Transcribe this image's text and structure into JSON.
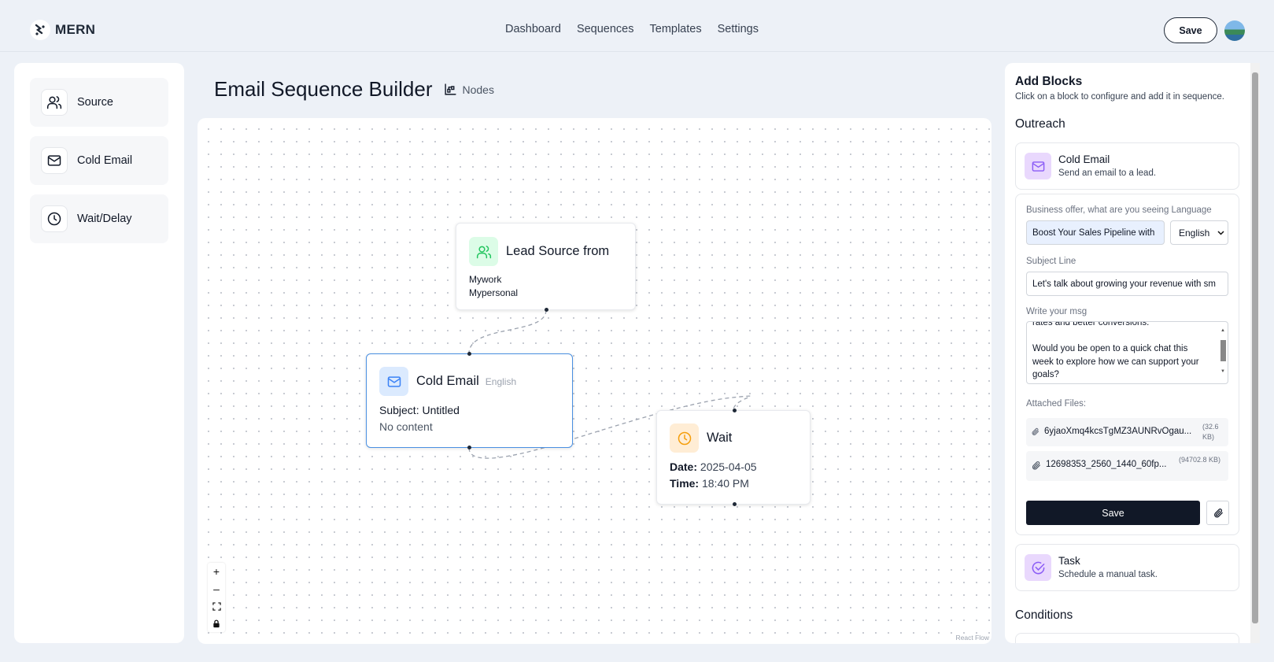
{
  "app": {
    "logo_text": "MERN"
  },
  "nav": {
    "items": [
      "Dashboard",
      "Sequences",
      "Templates",
      "Settings"
    ]
  },
  "header": {
    "save_label": "Save"
  },
  "sidebar": {
    "items": [
      {
        "label": "Source",
        "icon": "users-icon"
      },
      {
        "label": "Cold Email",
        "icon": "mail-icon"
      },
      {
        "label": "Wait/Delay",
        "icon": "clock-icon"
      }
    ]
  },
  "main": {
    "title": "Email Sequence Builder",
    "nodes_label": "Nodes"
  },
  "flow": {
    "lead_node": {
      "title": "Lead Source from",
      "lines": [
        "Mywork",
        "Mypersonal"
      ]
    },
    "email_node": {
      "title": "Cold Email",
      "language": "English",
      "subject_label": "Subject: Untitled",
      "content": "No content"
    },
    "wait_node": {
      "title": "Wait",
      "date_label": "Date:",
      "date": "2025-04-05",
      "time_label": "Time:",
      "time": "18:40 PM"
    },
    "zoom_controls": [
      "+",
      "–",
      "fit",
      "lock"
    ],
    "attribution": "React Flow"
  },
  "right_panel": {
    "title": "Add Blocks",
    "subtitle": "Click on a block to configure and add it in sequence.",
    "outreach_heading": "Outreach",
    "cold_email_block": {
      "name": "Cold Email",
      "desc": "Send an email to a lead."
    },
    "form": {
      "offer_label": "Business offer, what are you seeing Language",
      "offer_value": "Boost Your Sales Pipeline with",
      "language_value": "English",
      "subject_label": "Subject Line",
      "subject_value": "Let's talk about growing your revenue with sm",
      "msg_label": "Write your msg",
      "msg_lines": [
        "rates and better conversions.",
        "",
        "Would you be open to a quick chat this",
        "week to explore how we can support your",
        "goals?"
      ],
      "files_label": "Attached Files:",
      "files": [
        {
          "name": "6yjaoXmq4kcsTgMZ3AUNRvOgau...",
          "size": "(32.6 KB)"
        },
        {
          "name": "12698353_2560_1440_60fp...",
          "size": "(94702.8 KB)"
        }
      ],
      "save_label": "Save"
    },
    "task_block": {
      "name": "Task",
      "desc": "Schedule a manual task."
    },
    "conditions_heading": "Conditions"
  },
  "colors": {
    "accent_blue": "#3b82f6",
    "lead_green": "#22c55e",
    "wait_orange": "#f59e0b",
    "block_purple": "#8b5cf6",
    "dark": "#111827"
  }
}
